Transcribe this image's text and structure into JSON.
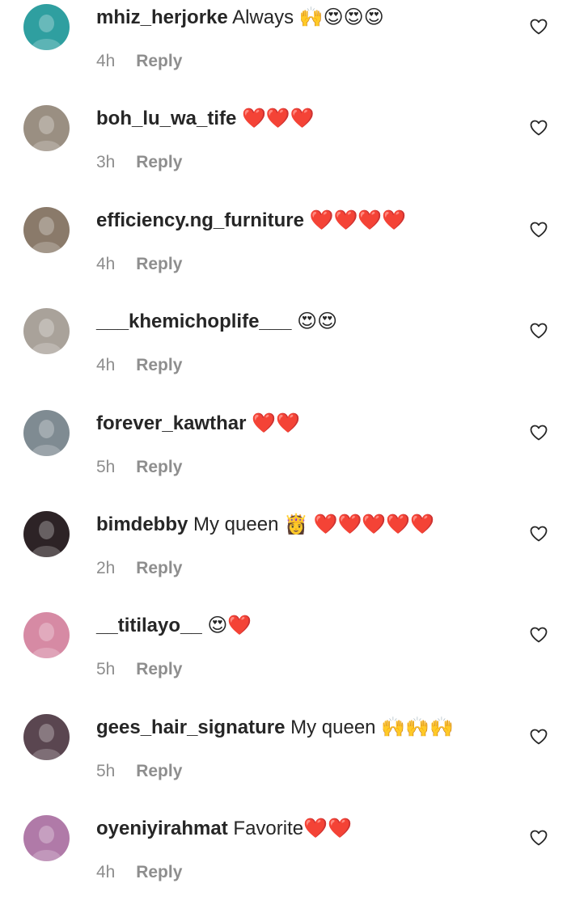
{
  "icons": {
    "like": "heart-outline-icon"
  },
  "colors": {
    "text": "#262626",
    "meta": "#8e8e8e",
    "background": "#ffffff"
  },
  "comments": [
    {
      "username": "mhiz_herjorke",
      "text": "Always 🙌😍😍😍",
      "time": "4h",
      "reply_label": "Reply",
      "avatar_color": "#2f9fa0"
    },
    {
      "username": "boh_lu_wa_tife",
      "text": "❤️❤️❤️",
      "time": "3h",
      "reply_label": "Reply",
      "avatar_color": "#9a8f82"
    },
    {
      "username": "efficiency.ng_furniture",
      "text": "❤️❤️❤️❤️",
      "time": "4h",
      "reply_label": "Reply",
      "avatar_color": "#8a7a6a"
    },
    {
      "username": "___khemichoplife___",
      "text": "😍😍",
      "time": "4h",
      "reply_label": "Reply",
      "avatar_color": "#a9a29a"
    },
    {
      "username": "forever_kawthar",
      "text": "❤️❤️",
      "time": "5h",
      "reply_label": "Reply",
      "avatar_color": "#7f8b92"
    },
    {
      "username": "bimdebby",
      "text": "My queen 👸 ❤️❤️❤️❤️❤️",
      "time": "2h",
      "reply_label": "Reply",
      "avatar_color": "#2d2326"
    },
    {
      "username": "__titilayo__",
      "text": "😍❤️",
      "time": "5h",
      "reply_label": "Reply",
      "avatar_color": "#d68aa4"
    },
    {
      "username": "gees_hair_signature",
      "text": "My queen 🙌🙌🙌",
      "time": "5h",
      "reply_label": "Reply",
      "avatar_color": "#5a4650"
    },
    {
      "username": "oyeniyirahmat",
      "text": "Favorite❤️❤️",
      "time": "4h",
      "reply_label": "Reply",
      "avatar_color": "#b07aa8"
    }
  ]
}
